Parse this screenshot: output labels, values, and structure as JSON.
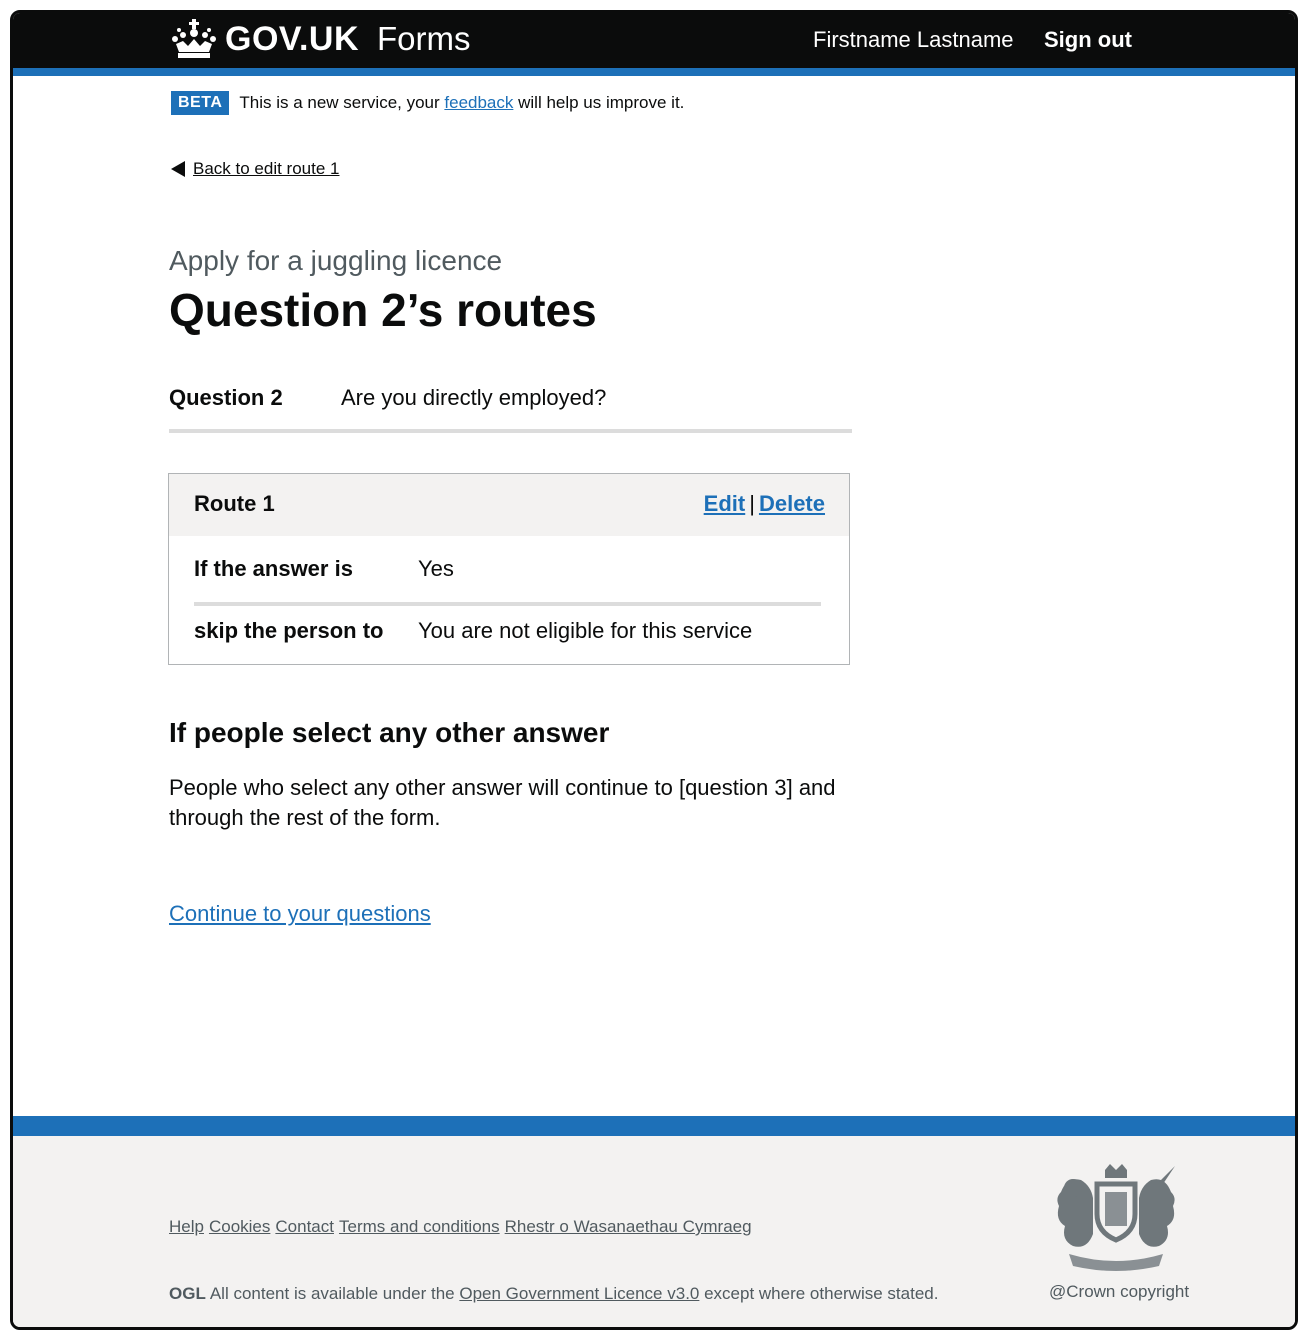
{
  "header": {
    "logo_text": "GOV.UK",
    "service_name": "Forms",
    "user_name": "Firstname Lastname",
    "sign_out": "Sign out"
  },
  "phase_banner": {
    "tag": "BETA",
    "text_before": "This is a new service, your ",
    "link": "feedback",
    "text_after": " will help us improve it."
  },
  "back_link": "Back to edit route 1",
  "caption": "Apply for a juggling licence",
  "title": "Question 2’s routes",
  "question": {
    "key": "Question 2",
    "value": "Are you directly employed?"
  },
  "route": {
    "title": "Route 1",
    "edit": "Edit",
    "separator": "|",
    "delete": "Delete",
    "rows": [
      {
        "key": "If the answer is",
        "value": "Yes"
      },
      {
        "key": "skip the person to",
        "value": "You are not eligible for this service"
      }
    ]
  },
  "other_answer": {
    "heading": "If people select any other answer",
    "body": "People who select any other answer will continue to [question 3] and through the rest of the form."
  },
  "continue_link": "Continue to your questions",
  "footer": {
    "links": [
      "Help",
      "Cookies",
      "Contact",
      "Terms and conditions",
      "Rhestr o Wasanaethau Cymraeg"
    ],
    "ogl": "OGL",
    "licence_before": "All content is available under the ",
    "licence_link": "Open Government Licence v3.0",
    "licence_after": " except where otherwise stated.",
    "copyright": "@Crown copyright"
  },
  "colors": {
    "brand_blue": "#1d70b8",
    "header_black": "#0b0c0c",
    "footer_grey": "#f3f2f1",
    "secondary_text": "#505a5f"
  },
  "icons": [
    "crown-icon",
    "back-arrow-icon",
    "royal-crest-icon"
  ]
}
